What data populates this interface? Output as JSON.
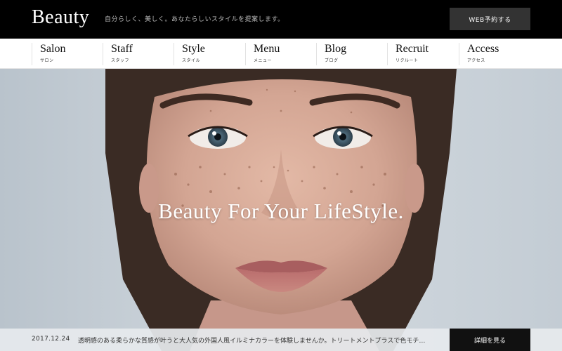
{
  "header": {
    "logo": "Beauty",
    "tagline": "自分らしく、美しく。あなたらしいスタイルを提案します。",
    "reserve_label": "WEB予約する"
  },
  "nav": {
    "items": [
      {
        "en": "Salon",
        "jp": "サロン"
      },
      {
        "en": "Staff",
        "jp": "スタッフ"
      },
      {
        "en": "Style",
        "jp": "スタイル"
      },
      {
        "en": "Menu",
        "jp": "メニュー"
      },
      {
        "en": "Blog",
        "jp": "ブログ"
      },
      {
        "en": "Recruit",
        "jp": "リクルート"
      },
      {
        "en": "Access",
        "jp": "アクセス"
      }
    ]
  },
  "hero": {
    "title": "Beauty For Your LifeStyle."
  },
  "news": {
    "date": "2017.12.24",
    "text": "透明感のある柔らかな質感が叶うと大人気の外国人風イルミナカラーを体験しませんか。トリートメントプラスで色モチ…",
    "button_label": "詳細を見る"
  },
  "colors": {
    "header_bg": "#000000",
    "button_bg": "#333333",
    "news_button_bg": "#111111"
  }
}
